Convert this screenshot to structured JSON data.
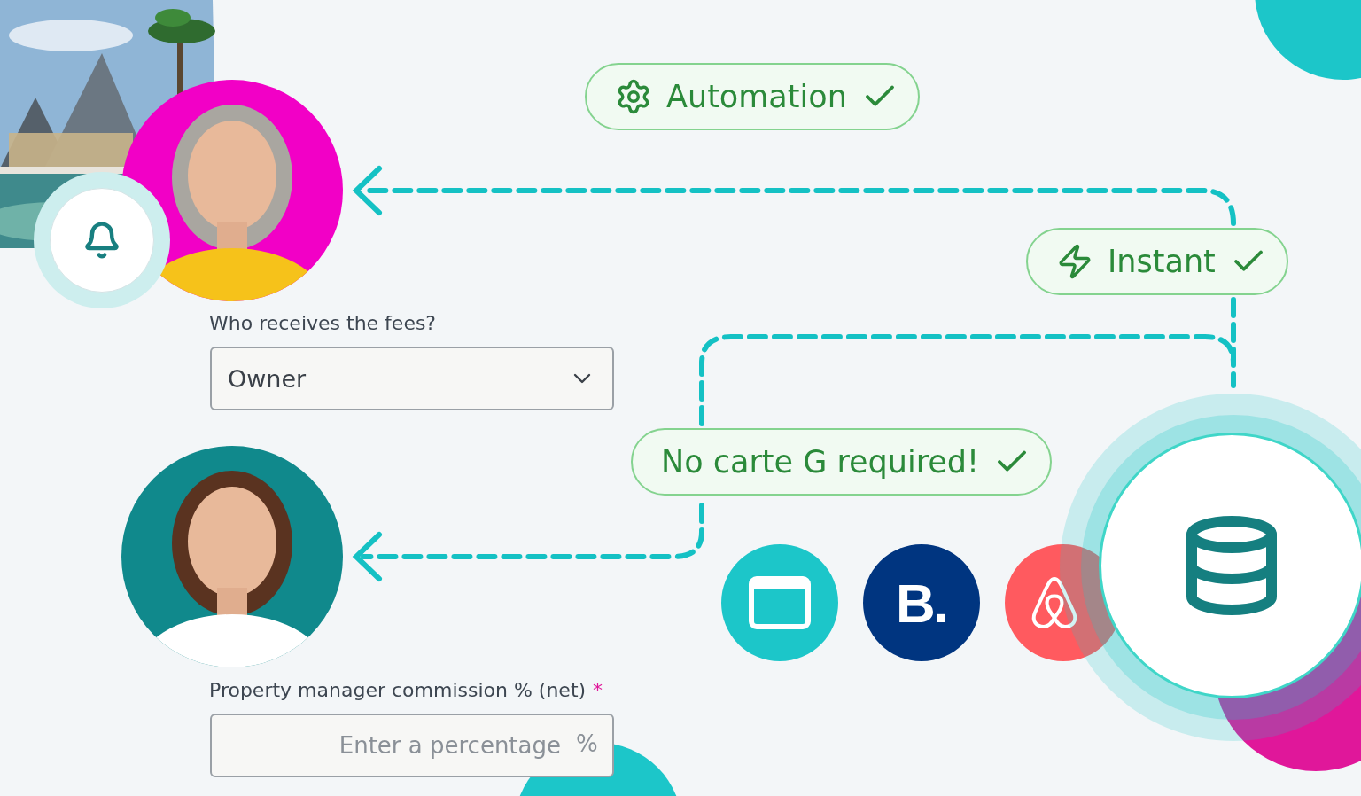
{
  "badges": [
    {
      "kind": "gear",
      "label": "Automation",
      "checked": true
    },
    {
      "kind": "bolt",
      "label": "Instant",
      "checked": true
    },
    {
      "kind": "plain",
      "label": "No carte G required!",
      "checked": true
    }
  ],
  "fields": [
    {
      "kind": "select",
      "label": "Who receives the fees?",
      "value": "Owner"
    },
    {
      "kind": "input",
      "label": "Property manager commission % (net)",
      "required": true,
      "required_mark": "*",
      "placeholder": "Enter a percentage",
      "suffix": "%"
    }
  ],
  "channels": [
    {
      "kind": "window",
      "color": "#1cc6c9"
    },
    {
      "kind": "letter",
      "text": "B.",
      "color": "#003580"
    },
    {
      "kind": "loop",
      "color": "#ff5a5f"
    }
  ]
}
